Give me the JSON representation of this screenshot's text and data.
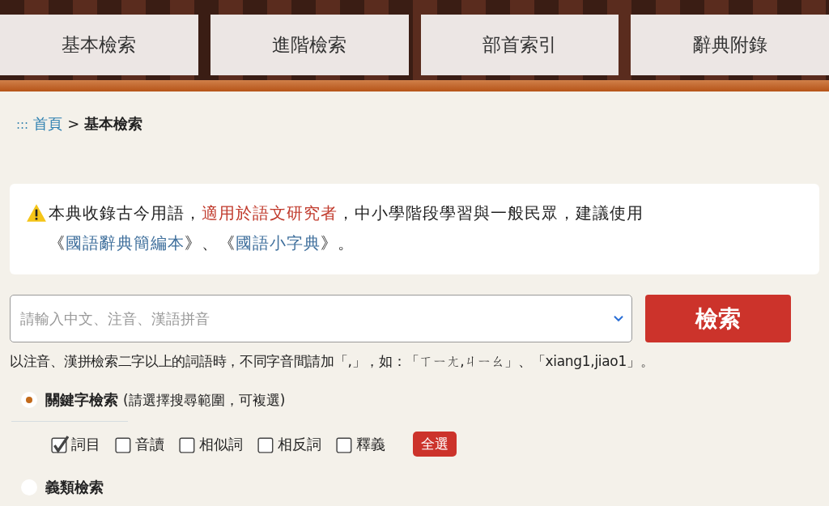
{
  "nav_tabs": [
    {
      "label": "基本檢索"
    },
    {
      "label": "進階檢索"
    },
    {
      "label": "部首索引"
    },
    {
      "label": "辭典附錄"
    }
  ],
  "breadcrumb": {
    "marker": ":::",
    "home": "首頁",
    "separator": ">",
    "current": "基本檢索"
  },
  "notice": {
    "segments": [
      {
        "kind": "text",
        "text": "本典收錄古今用語，"
      },
      {
        "kind": "highlight",
        "text": "適用於語文研究者"
      },
      {
        "kind": "text",
        "text": "，中小學階段學習與一般民眾，建議使用《"
      },
      {
        "kind": "link",
        "text": "國語辭典簡編本"
      },
      {
        "kind": "text",
        "text": "》、《"
      },
      {
        "kind": "link",
        "text": "國語小字典"
      },
      {
        "kind": "text",
        "text": "》。"
      }
    ]
  },
  "search": {
    "placeholder": "請輸入中文、注音、漢語拼音",
    "button": "檢索"
  },
  "hint": "以注音、漢拼檢索二字以上的詞語時，不同字音間請加「,」，如：「ㄒㄧㄤ,ㄐㄧㄠ」、「xiang1,jiao1」。",
  "modes": [
    {
      "label": "關鍵字檢索",
      "note": "(請選擇搜尋範圍，可複選)",
      "selected": true,
      "options": [
        {
          "label": "詞目",
          "checked": true
        },
        {
          "label": "音讀",
          "checked": false
        },
        {
          "label": "相似詞",
          "checked": false
        },
        {
          "label": "相反詞",
          "checked": false
        },
        {
          "label": "釋義",
          "checked": false
        }
      ],
      "select_all": "全選"
    },
    {
      "label": "義類檢索",
      "selected": false
    }
  ]
}
